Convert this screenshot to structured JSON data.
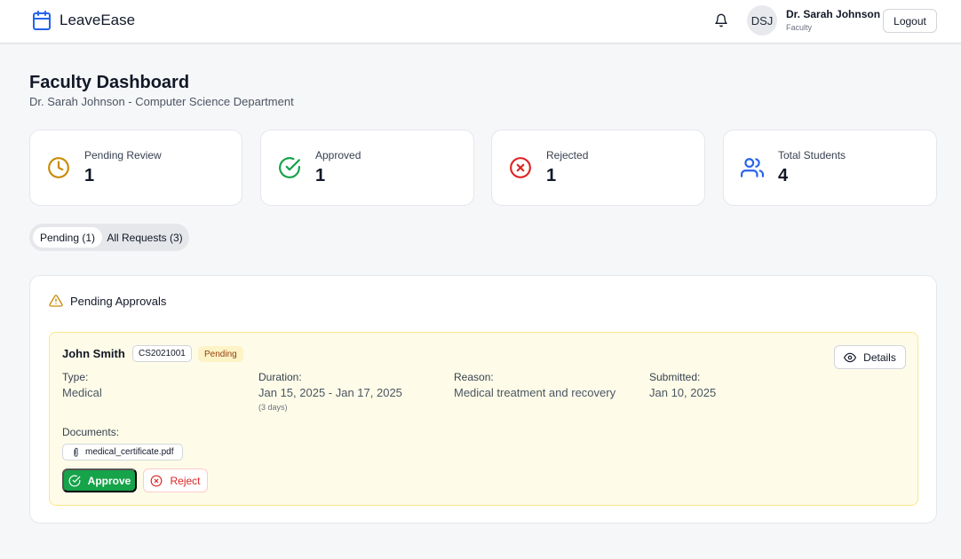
{
  "header": {
    "app_name": "LeaveEase",
    "avatar_initials": "DSJ",
    "user_name": "Dr. Sarah Johnson",
    "user_role": "Faculty",
    "logout_label": "Logout",
    "icons": {
      "logo": "calendar-icon",
      "notifications": "bell-icon"
    }
  },
  "page": {
    "title": "Faculty Dashboard",
    "subtitle": "Dr. Sarah Johnson - Computer Science Department"
  },
  "stats": [
    {
      "label": "Pending Review",
      "value": "1",
      "icon": "clock-icon",
      "color": "#ca8a04"
    },
    {
      "label": "Approved",
      "value": "1",
      "icon": "check-circle-icon",
      "color": "#16a34a"
    },
    {
      "label": "Rejected",
      "value": "1",
      "icon": "x-circle-icon",
      "color": "#dc2626"
    },
    {
      "label": "Total Students",
      "value": "4",
      "icon": "users-icon",
      "color": "#2563eb"
    }
  ],
  "tabs": [
    {
      "label": "Pending (1)",
      "active": true
    },
    {
      "label": "All Requests (3)",
      "active": false
    }
  ],
  "panel": {
    "title": "Pending Approvals",
    "icon": "warning-icon"
  },
  "request": {
    "student_name": "John Smith",
    "student_id": "CS2021001",
    "status": "Pending",
    "details_label": "Details",
    "fields": {
      "type_label": "Type:",
      "type_value": "Medical",
      "duration_label": "Duration:",
      "duration_value": "Jan 15, 2025 - Jan 17, 2025",
      "duration_note": "(3 days)",
      "reason_label": "Reason:",
      "reason_value": "Medical treatment and recovery",
      "submitted_label": "Submitted:",
      "submitted_value": "Jan 10, 2025"
    },
    "documents_label": "Documents:",
    "documents": [
      "medical_certificate.pdf"
    ],
    "approve_label": "Approve",
    "reject_label": "Reject"
  },
  "colors": {
    "accent": "#2563eb",
    "approve": "#16a34a",
    "reject": "#dc2626",
    "pending_bg": "#fefce8",
    "pending_border": "#fde68a"
  }
}
